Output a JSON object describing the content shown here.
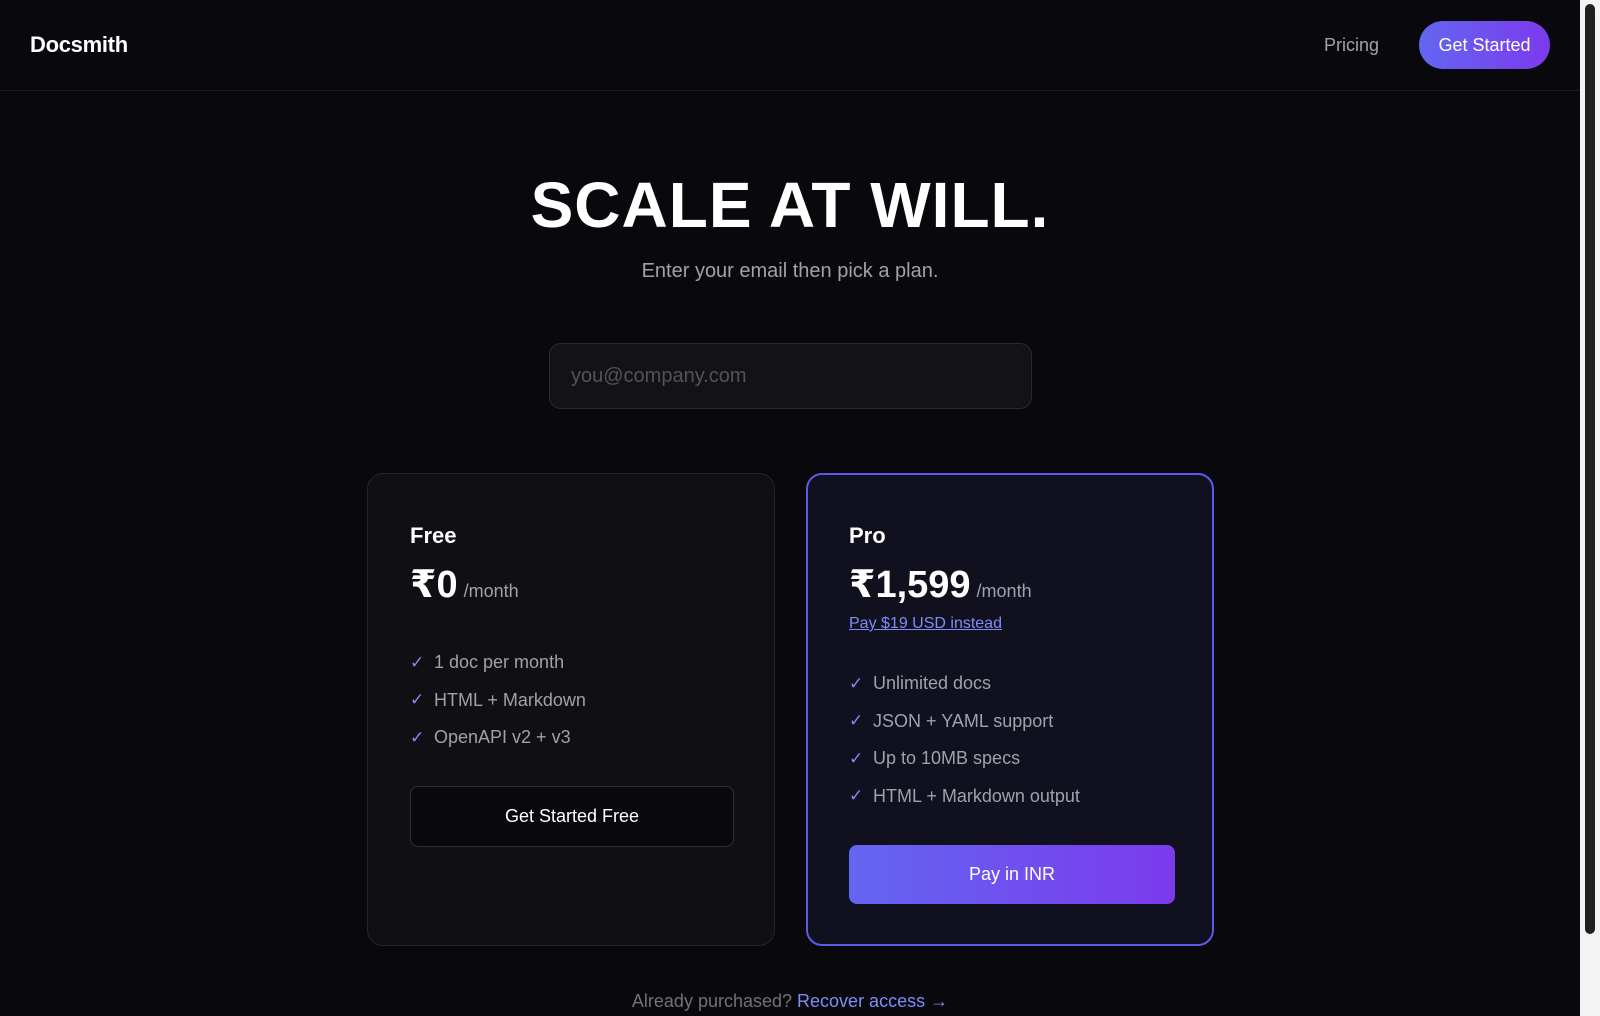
{
  "header": {
    "brand": "Docsmith",
    "nav_pricing": "Pricing",
    "cta_label": "Get Started"
  },
  "hero": {
    "title": "SCALE AT WILL.",
    "subtitle": "Enter your email then pick a plan.",
    "email_placeholder": "you@company.com"
  },
  "plans": {
    "free": {
      "name": "Free",
      "price": "₹0",
      "period": "/month",
      "features": [
        "1 doc per month",
        "HTML + Markdown",
        "OpenAPI v2 + v3"
      ],
      "button_label": "Get Started Free"
    },
    "pro": {
      "name": "Pro",
      "price": "₹1,599",
      "period": "/month",
      "alt_price_link": "Pay $19 USD instead",
      "features": [
        "Unlimited docs",
        "JSON + YAML support",
        "Up to 10MB specs",
        "HTML + Markdown output"
      ],
      "button_label": "Pay in INR"
    }
  },
  "footer": {
    "prompt": "Already purchased?",
    "recover_link": "Recover access →"
  },
  "icons": {
    "check_glyph": "✓"
  },
  "colors": {
    "background": "#09090d",
    "accent": "#818cf8",
    "gradient_start": "#6366f1",
    "gradient_end": "#7c3aed",
    "pro_border": "#5b5bea"
  }
}
